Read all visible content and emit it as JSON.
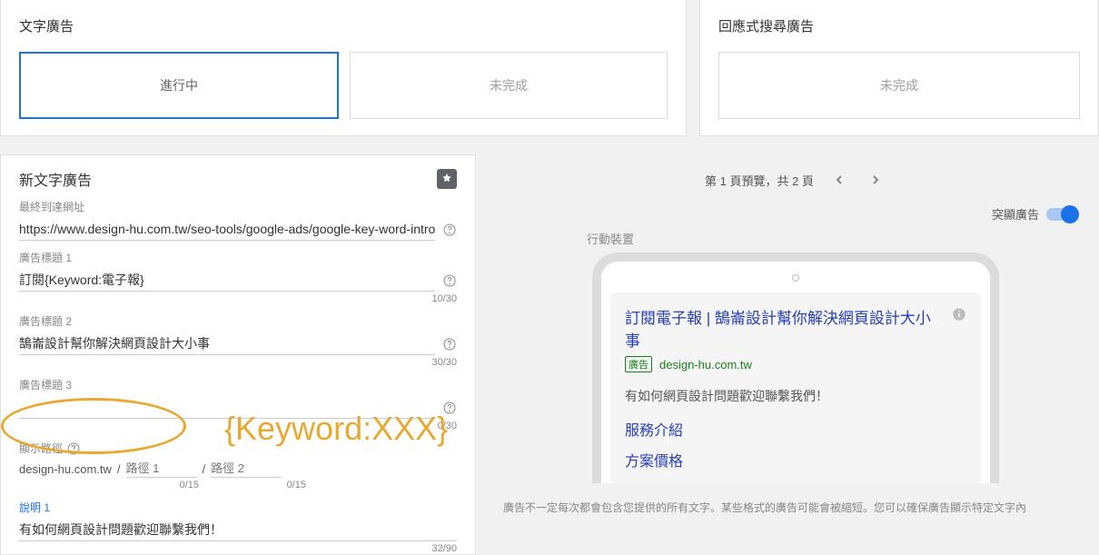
{
  "topLeft": {
    "title": "文字廣告",
    "buttons": [
      "進行中",
      "未完成"
    ]
  },
  "topRight": {
    "title": "回應式搜尋廣告",
    "button": "未完成"
  },
  "form": {
    "title": "新文字廣告",
    "finalUrl": {
      "label": "最終到達網址",
      "value": "https://www.design-hu.com.tw/seo-tools/google-ads/google-key-word-introduction"
    },
    "headline1": {
      "label": "廣告標題 1",
      "value": "訂閱{Keyword:電子報}",
      "counter": "10/30"
    },
    "headline2": {
      "label": "廣告標題 2",
      "value": "鵠崙設計幫你解決網頁設計大小事",
      "counter": "30/30"
    },
    "headline3": {
      "label": "廣告標題 3",
      "value": "",
      "counter": "0/30"
    },
    "displayPath": {
      "label": "顯示路徑",
      "domain": "design-hu.com.tw",
      "path1Placeholder": "路徑 1",
      "path2Placeholder": "路徑 2",
      "counter1": "0/15",
      "counter2": "0/15"
    },
    "desc1": {
      "label": "說明 1",
      "value": "有如何網頁設計問題歡迎聯繫我們！",
      "counter": "32/90"
    }
  },
  "annotation": "{Keyword:XXX}",
  "preview": {
    "pager": "第 1 頁預覽，共 2 頁",
    "highlightLabel": "突顯廣告",
    "deviceLabel": "行動裝置",
    "ad": {
      "headline": "訂閱電子報 | 鵠崙設計幫你解決網頁設計大小事",
      "badge": "廣告",
      "domain": "design-hu.com.tw",
      "desc": "有如何網頁設計問題歡迎聯繫我們！",
      "link1": "服務介紹",
      "link2": "方案價格"
    },
    "note": "廣告不一定每次都會包含您提供的所有文字。某些格式的廣告可能會被縮短。您可以確保廣告顯示特定文字內"
  }
}
